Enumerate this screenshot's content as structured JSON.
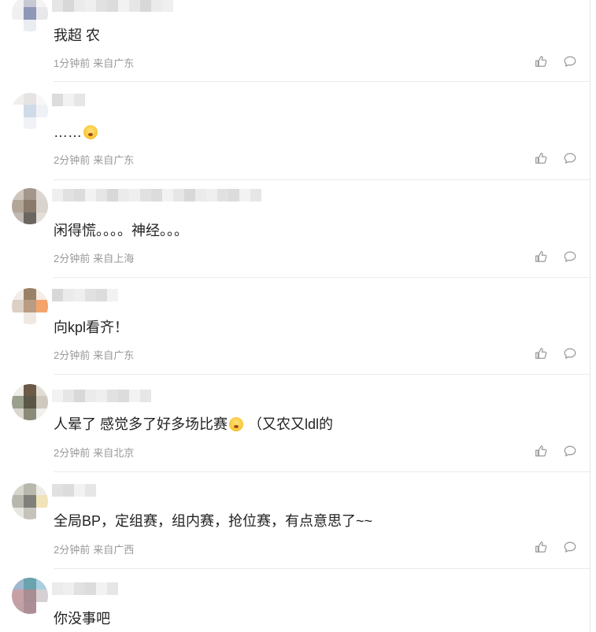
{
  "comments": [
    {
      "text": "我超 农",
      "time": "1分钟前",
      "location": "来自广东",
      "emoji": false,
      "avatar": [
        "#f2f2f2",
        "#c9c9d6",
        "#f4f4f4",
        "#f0f0f0",
        "#8e98b8",
        "#e8e8ea",
        "#ffffff",
        "#e9ecf1",
        "#ffffff"
      ],
      "name_len": 11
    },
    {
      "text": "……",
      "time": "2分钟前",
      "location": "来自广东",
      "emoji": true,
      "avatar": [
        "#f1eeee",
        "#e7e3e3",
        "#f7f7f7",
        "#ffffff",
        "#cfdbe8",
        "#eef2f6",
        "#ffffff",
        "#f0f2f5",
        "#ffffff"
      ],
      "name_len": 3
    },
    {
      "text": "闲得慌。。。。神经。。。",
      "time": "2分钟前",
      "location": "来自上海",
      "emoji": false,
      "avatar": [
        "#cfc6bf",
        "#a4968a",
        "#dcd6d0",
        "#b2a698",
        "#8a7a6c",
        "#d8d3cc",
        "#bfb9b2",
        "#6c6660",
        "#e3ded8"
      ],
      "name_len": 19
    },
    {
      "text": "向kpl看齐！",
      "time": "2分钟前",
      "location": "来自广东",
      "emoji": false,
      "avatar": [
        "#f2ece8",
        "#9a8168",
        "#f5ede6",
        "#dccfc3",
        "#b89d84",
        "#f4a36b",
        "#ffffff",
        "#f0e9e3",
        "#ffffff"
      ],
      "name_len": 6
    },
    {
      "text": "人晕了 感觉多了好多场比赛",
      "text2": "（又农又ldl的",
      "time": "2分钟前",
      "location": "来自北京",
      "emoji": true,
      "avatar": [
        "#efede7",
        "#6b5a48",
        "#e1ddd5",
        "#9aa08c",
        "#5a5648",
        "#cfc9bf",
        "#d9d7cf",
        "#8b8a79",
        "#f2f0ea"
      ],
      "name_len": 9
    },
    {
      "text": "全局BP，定组赛，组内赛，抢位赛，有点意思了~~",
      "time": "2分钟前",
      "location": "来自广西",
      "emoji": false,
      "avatar": [
        "#d8d5cc",
        "#b9b8ad",
        "#ecebe6",
        "#b8b7ae",
        "#7f8079",
        "#f1e3b8",
        "#e7e6e1",
        "#c5c3ba",
        "#ffffff"
      ],
      "name_len": 4
    },
    {
      "text": "你没事吧",
      "time": "",
      "location": "",
      "emoji": false,
      "avatar": [
        "#9fb7cf",
        "#6aa3ad",
        "#a9cfe0",
        "#c7a0a5",
        "#a88d92",
        "#d6cfd4",
        "#c0a1a6",
        "#ad8e96",
        "#ffffff"
      ],
      "name_len": 6
    }
  ]
}
